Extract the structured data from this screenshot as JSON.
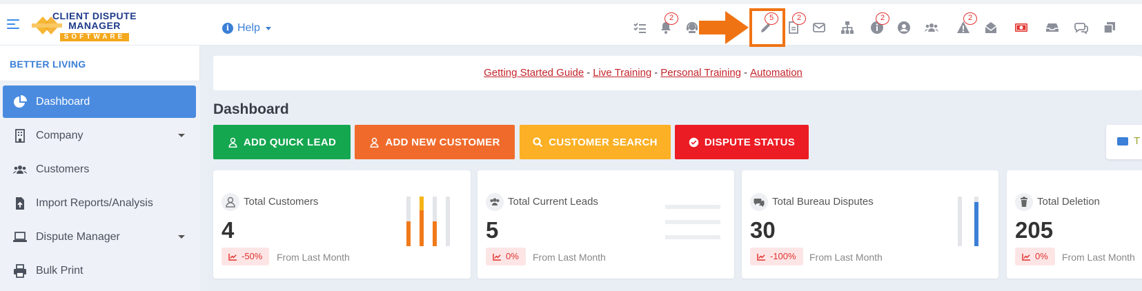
{
  "app": {
    "logo_line1": "CLIENT DISPUTE",
    "logo_line2": "MANAGER",
    "logo_line3": "SOFTWARE"
  },
  "header": {
    "help_label": "Help",
    "badges": {
      "notifications": "2",
      "highlighted": "5",
      "documents": "2",
      "info": "2",
      "alerts": "2"
    }
  },
  "sidebar": {
    "org_name": "BETTER LIVING",
    "items": [
      {
        "label": "Dashboard",
        "icon": "pie-chart-icon",
        "active": true
      },
      {
        "label": "Company",
        "icon": "building-icon"
      },
      {
        "label": "Customers",
        "icon": "users-icon"
      },
      {
        "label": "Import Reports/Analysis",
        "icon": "file-import-icon"
      },
      {
        "label": "Dispute Manager",
        "icon": "laptop-icon"
      },
      {
        "label": "Bulk Print",
        "icon": "printer-icon"
      }
    ]
  },
  "links_bar": {
    "getting_started": "Getting Started Guide",
    "live_training": "Live Training",
    "personal_training": "Personal Training",
    "automation": "Automation",
    "separator": "-"
  },
  "main": {
    "title": "Dashboard",
    "buttons": {
      "add_quick_lead": "ADD QUICK LEAD",
      "add_new_customer": "ADD NEW CUSTOMER",
      "customer_search": "CUSTOMER SEARCH",
      "dispute_status": "DISPUTE STATUS"
    },
    "zoom_label": "T",
    "cards": [
      {
        "label": "Total Customers",
        "value": "4",
        "change": "-50%",
        "from": "From Last Month"
      },
      {
        "label": "Total Current Leads",
        "value": "5",
        "change": "0%",
        "from": "From Last Month"
      },
      {
        "label": "Total Bureau Disputes",
        "value": "30",
        "change": "-100%",
        "from": "From Last Month"
      },
      {
        "label": "Total Deletion",
        "value": "205",
        "change": "0%",
        "from": "From Last Month"
      }
    ]
  },
  "colors": {
    "accent": "#4a8be0",
    "green": "#15a650",
    "orange": "#f06b2b",
    "yellow": "#fbb025",
    "red": "#ec1c24",
    "highlight": "#f07313"
  }
}
